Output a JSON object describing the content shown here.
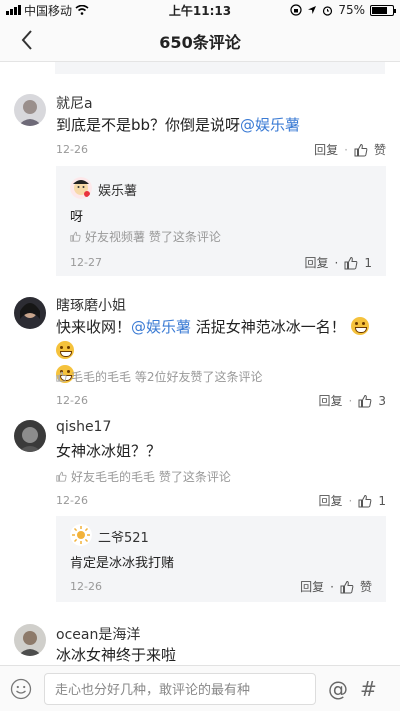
{
  "status": {
    "carrier": "中国移动",
    "time": "上午11:13",
    "battery": "75%",
    "battery_level": 0.75
  },
  "nav": {
    "back_icon": "chevron-left-icon",
    "title": "650条评论"
  },
  "comments": [
    {
      "user": "就尼a",
      "text_prefix": "到底是不是bb？你倒是说呀",
      "mention": "@娱乐薯",
      "date": "12-26",
      "reply_label": "回复",
      "like_label": "赞",
      "reply": {
        "user": "娱乐薯",
        "text": "呀",
        "liked_by": "好友视频薯 赞了这条评论",
        "date": "12-27",
        "reply_label": "回复",
        "like_count": "1"
      }
    },
    {
      "user": "瞎琢磨小姐",
      "text_prefix": "快来收网！",
      "mention": "@娱乐薯",
      "text_suffix": " 活捉女神范冰冰一名！",
      "liked_by": "毛毛的毛毛 等2位好友赞了这条评论",
      "date": "12-26",
      "reply_label": "回复",
      "like_count": "3"
    },
    {
      "user": "qishe17",
      "text": "女神冰冰姐？？",
      "liked_by": "好友毛毛的毛毛 赞了这条评论",
      "date": "12-26",
      "reply_label": "回复",
      "like_count": "1",
      "reply": {
        "user": "二爷521",
        "text": "肯定是冰冰我打赌",
        "date": "12-26",
        "reply_label": "回复",
        "like_label": "赞"
      }
    },
    {
      "user": "ocean是海洋",
      "text": "冰冰女神终于来啦"
    }
  ],
  "bottom": {
    "placeholder": "走心也分好几种，敢评论的最有种",
    "at_symbol": "@",
    "hash_symbol": "#"
  }
}
